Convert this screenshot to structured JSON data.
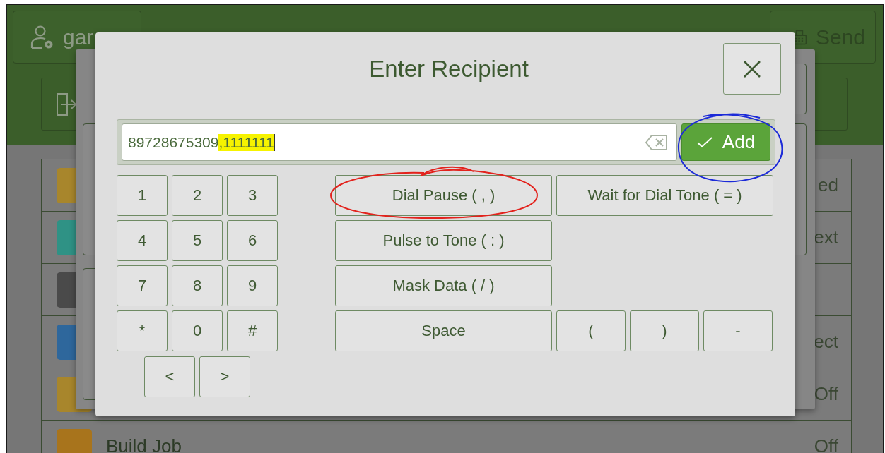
{
  "background": {
    "user_button": {
      "label": "gar"
    },
    "send_button": {
      "label": "Send"
    },
    "list_rows": [
      {
        "color": "#a8862c",
        "value": "ed"
      },
      {
        "color": "#2f9285",
        "value": "ext"
      },
      {
        "color": "#4a4a4a"
      },
      {
        "color": "#2e679c",
        "value": "ect"
      },
      {
        "color": "#a8862c",
        "value": "Off"
      },
      {
        "color": "#a8741c",
        "label": "Build Job",
        "value": "Off"
      }
    ]
  },
  "dialog": {
    "title": "Enter Recipient",
    "recipient_field": {
      "parts": [
        {
          "text": "89728675309",
          "highlighted": false
        },
        {
          "text": ",1111111",
          "highlighted": true
        }
      ]
    },
    "add_button": {
      "label": "Add"
    },
    "keypad": [
      "1",
      "2",
      "3",
      "4",
      "5",
      "6",
      "7",
      "8",
      "9",
      "*",
      "0",
      "#"
    ],
    "cursor_keys": [
      "<",
      ">"
    ],
    "dial_rows": [
      [
        {
          "label": "Dial Pause ( , )",
          "kind": "wide"
        },
        {
          "label": "Wait for Dial Tone ( = )",
          "kind": "wide"
        }
      ],
      [
        {
          "label": "Pulse to Tone ( : )",
          "kind": "wide"
        }
      ],
      [
        {
          "label": "Mask Data ( / )",
          "kind": "wide"
        }
      ],
      [
        {
          "label": "Space",
          "kind": "wide"
        },
        {
          "label": "(",
          "kind": "narrow"
        },
        {
          "label": ")",
          "kind": "narrow"
        },
        {
          "label": "-",
          "kind": "narrow"
        }
      ]
    ]
  },
  "annotations": [
    {
      "kind": "ellipse-around-dial-pause",
      "color": "#e3221c"
    },
    {
      "kind": "ellipse-around-add",
      "color": "#1b2ad8"
    }
  ]
}
